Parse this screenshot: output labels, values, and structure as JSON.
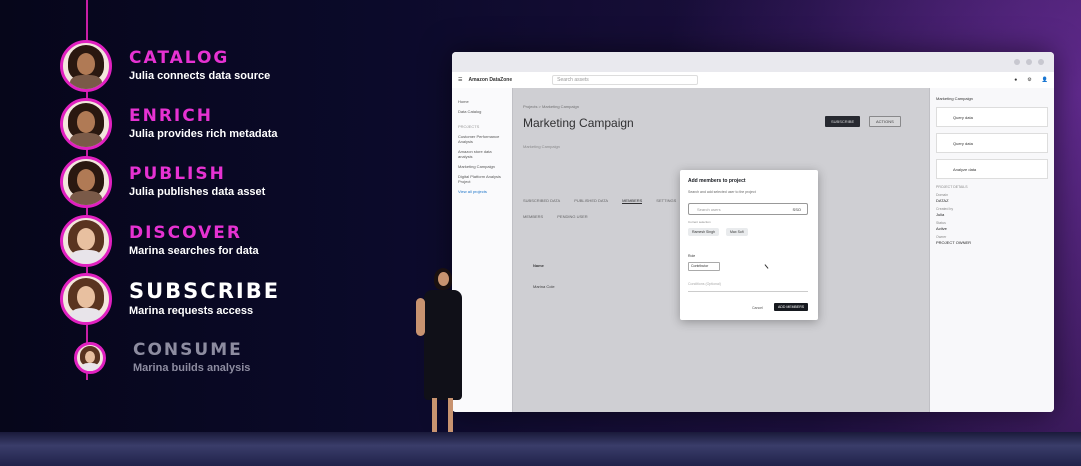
{
  "steps": [
    {
      "title": "CATALOG",
      "desc": "Julia connects data source",
      "persona": "julia"
    },
    {
      "title": "ENRICH",
      "desc": "Julia provides rich metadata",
      "persona": "julia"
    },
    {
      "title": "PUBLISH",
      "desc": "Julia publishes data asset",
      "persona": "julia"
    },
    {
      "title": "DISCOVER",
      "desc": "Marina searches for data",
      "persona": "marina"
    },
    {
      "title": "SUBSCRIBE",
      "desc": "Marina requests access",
      "persona": "marina",
      "state": "active"
    },
    {
      "title": "CONSUME",
      "desc": "Marina builds analysis",
      "persona": "marina",
      "state": "dim"
    }
  ],
  "colors": {
    "accent": "#e632d2",
    "rail": "#c81ea6",
    "dim": "#8d8ca0"
  },
  "screen": {
    "brand": "Amazon DataZone",
    "search_placeholder": "Search assets",
    "breadcrumb": "Projects > Marketing Campaign",
    "page_title": "Marketing Campaign",
    "subtitle": "Marketing Campaign",
    "header_buttons": {
      "primary": "SUBSCRIBE",
      "secondary": "ACTIONS"
    },
    "nav": {
      "home": "Home",
      "catalog": "Data Catalog",
      "heading": "PROJECTS",
      "projects": [
        "Customer Performance Analysis",
        "Amazon store data analysis",
        "Marketing Campaign",
        "Digital Platform Analysis Project"
      ],
      "link": "View all projects"
    },
    "tabs": [
      "SUBSCRIBED DATA",
      "PUBLISHED DATA",
      "MEMBERS",
      "SETTINGS"
    ],
    "active_tab": "MEMBERS",
    "subtabs": [
      "MEMBERS",
      "PENDING USER"
    ],
    "table": {
      "header": "Name",
      "row": "Marina Cole"
    },
    "right_panel": {
      "title": "Marketing Campaign",
      "cards": [
        "Query data",
        "Query data",
        "Analyze data"
      ],
      "fields": [
        {
          "label": "PROJECT DETAILS",
          "value": ""
        },
        {
          "label": "Domain",
          "value": "DATAZ"
        },
        {
          "label": "Created by",
          "value": "Julia"
        },
        {
          "label": "Status",
          "value": "Active"
        },
        {
          "label": "Owner",
          "value": "PROJECT OWNER"
        }
      ]
    },
    "modal": {
      "title": "Add members to project",
      "desc": "Search and add selected user to the project",
      "search_placeholder": "Search users",
      "scope": "SSO",
      "chips_label": "Current selection",
      "chips": [
        "Ramesh Singh",
        "Max Sofi"
      ],
      "role_label": "Role",
      "role_value": "Contributor",
      "conditions": "Conditions (Optional)",
      "cancel": "Cancel",
      "submit": "ADD MEMBERS"
    }
  }
}
